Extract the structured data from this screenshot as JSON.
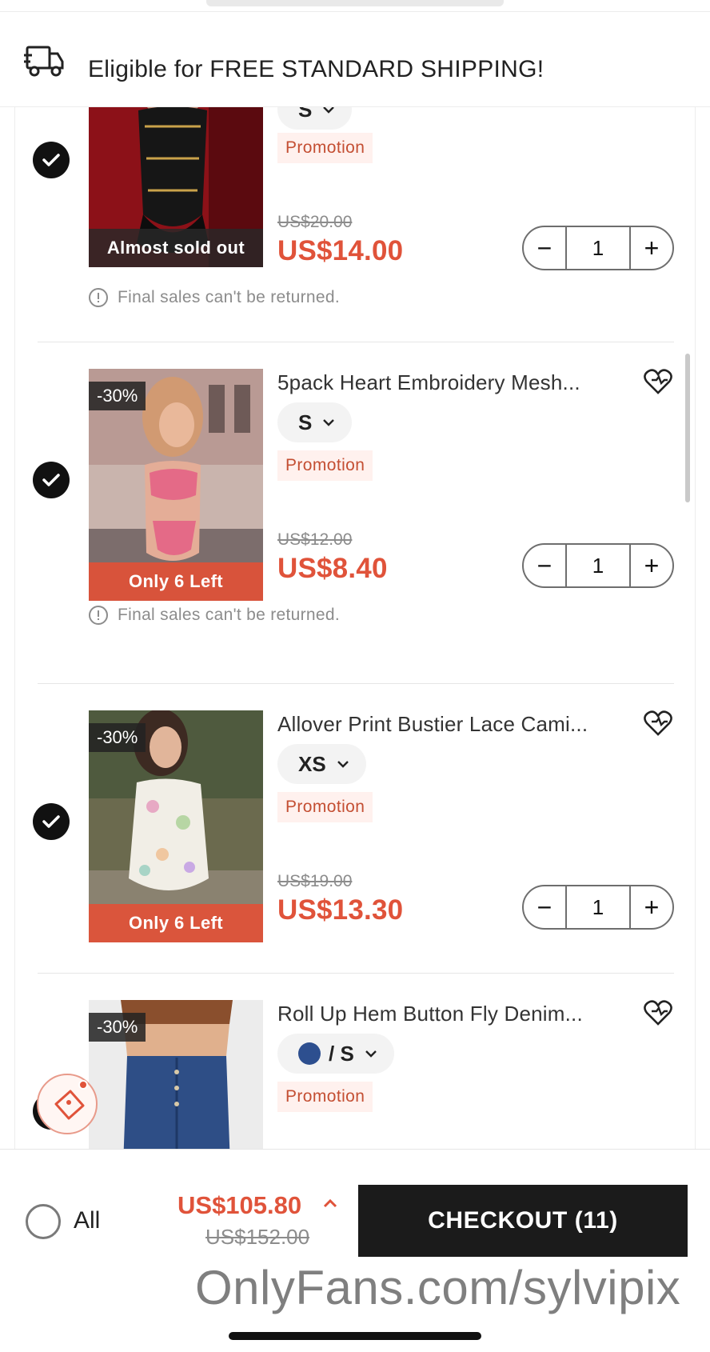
{
  "shipping": {
    "icon": "truck-icon",
    "text": "Eligible for FREE STANDARD SHIPPING!"
  },
  "items": [
    {
      "checked": true,
      "badge": "",
      "stock_label": "Almost sold out",
      "title": "",
      "size": "S",
      "promo": "Promotion",
      "old_price": "US$20.00",
      "price": "US$14.00",
      "qty": "1",
      "note": "Final sales can't be returned."
    },
    {
      "checked": true,
      "badge": "-30%",
      "stock_label": "Only 6 Left",
      "title": "5pack Heart Embroidery Mesh...",
      "size": "S",
      "promo": "Promotion",
      "old_price": "US$12.00",
      "price": "US$8.40",
      "qty": "1",
      "note": "Final sales can't be returned."
    },
    {
      "checked": true,
      "badge": "-30%",
      "stock_label": "Only 6 Left",
      "title": "Allover Print Bustier Lace Cami...",
      "size": "XS",
      "promo": "Promotion",
      "old_price": "US$19.00",
      "price": "US$13.30",
      "qty": "1"
    },
    {
      "checked": true,
      "badge": "-30%",
      "title": "Roll Up Hem Button Fly Denim...",
      "size": "/ S",
      "color_swatch": "#2d4f8f",
      "promo": "Promotion"
    }
  ],
  "stepper": {
    "minus": "−",
    "plus": "+"
  },
  "footer": {
    "all_label": "All",
    "total": "US$105.80",
    "total_old": "US$152.00",
    "checkout_label": "CHECKOUT (11)"
  },
  "watermark": "OnlyFans.com/sylvipix",
  "colors": {
    "accent": "#e0533a",
    "promo_bg": "#fff1ee",
    "checkout_bg": "#1b1b1b"
  }
}
